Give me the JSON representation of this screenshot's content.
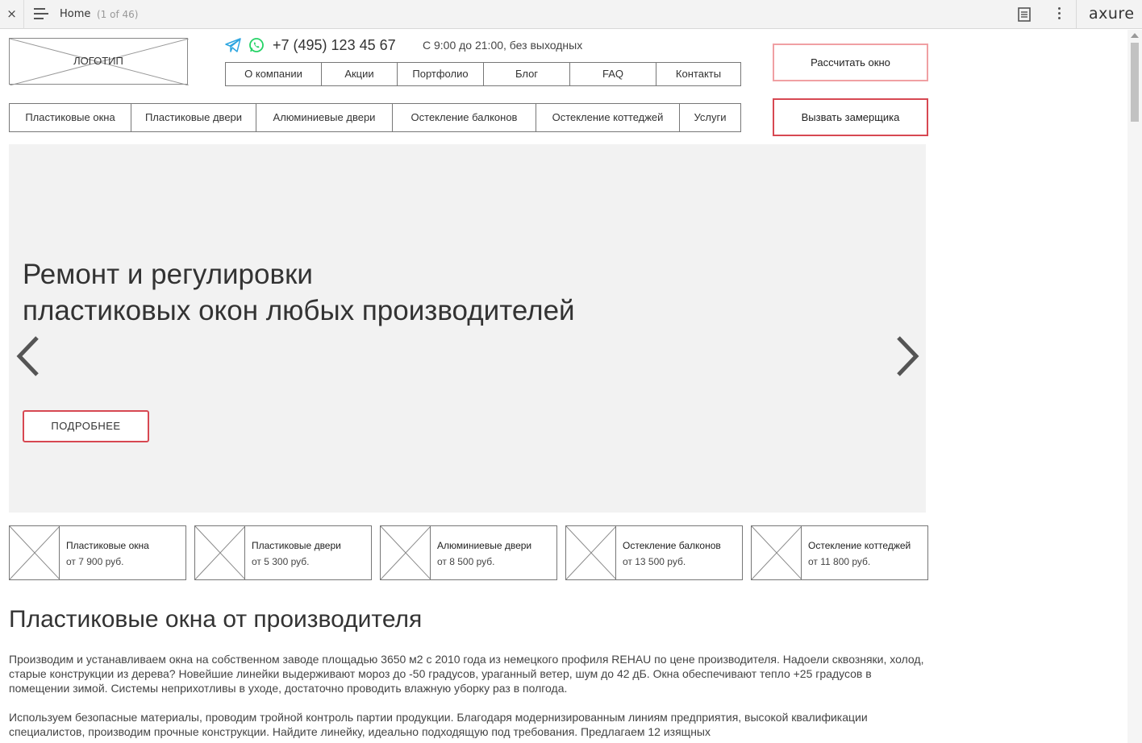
{
  "viewer": {
    "close_label": "×",
    "page_title": "Home",
    "page_count": "(1 of 46)",
    "brand": "axure"
  },
  "header": {
    "logo_text": "ЛОГОТИП",
    "phone": "+7 (495) 123 45 67",
    "hours": "С 9:00 до 21:00, без выходных",
    "icons": [
      "telegram-icon",
      "whatsapp-icon"
    ],
    "top_nav": [
      "О компании",
      "Акции",
      "Портфолио",
      "Блог",
      "FAQ",
      "Контакты"
    ],
    "category_nav": [
      "Пластиковые окна",
      "Пластиковые двери",
      "Алюминиевые двери",
      "Остекление балконов",
      "Остекление коттеджей",
      "Услуги"
    ],
    "calc_button": "Рассчитать окно",
    "measure_button": "Вызвать замерщика"
  },
  "hero": {
    "title_line1": "Ремонт и регулировки",
    "title_line2": "пластиковых окон любых производителей",
    "button": "ПОДРОБНЕЕ"
  },
  "products": [
    {
      "name": "Пластиковые окна",
      "price": "от 7 900 руб."
    },
    {
      "name": "Пластиковые двери",
      "price": "от 5 300 руб."
    },
    {
      "name": "Алюминиевые двери",
      "price": "от 8 500 руб."
    },
    {
      "name": "Остекление балконов",
      "price": "от 13 500 руб."
    },
    {
      "name": "Остекление коттеджей",
      "price": "от 11 800 руб."
    }
  ],
  "content": {
    "title": "Пластиковые окна от производителя",
    "paragraph1": "Производим и устанавливаем окна на собственном заводе площадью 3650 м2 с 2010 года из немецкого профиля REHAU по цене производителя. Надоели сквозняки, холод, старые конструкции из дерева? Новейшие линейки выдерживают мороз до -50 градусов, ураганный ветер, шум до 42 дБ. Окна обеспечивают тепло +25 градусов в помещении зимой. Системы неприхотливы в уходе, достаточно проводить влажную уборку раз в полгода.",
    "paragraph2": "Используем безопасные материалы, проводим тройной контроль партии продукции. Благодаря модернизированным линиям предприятия, высокой квалификации специалистов, производим прочные конструкции. Найдите линейку, идеально подходящую под требования. Предлагаем 12 изящных"
  },
  "colors": {
    "accent_red": "#d74852",
    "accent_pink": "#f0a0a3",
    "hero_bg": "#f2f2f2",
    "telegram": "#2ca5e0",
    "whatsapp": "#25d366"
  }
}
